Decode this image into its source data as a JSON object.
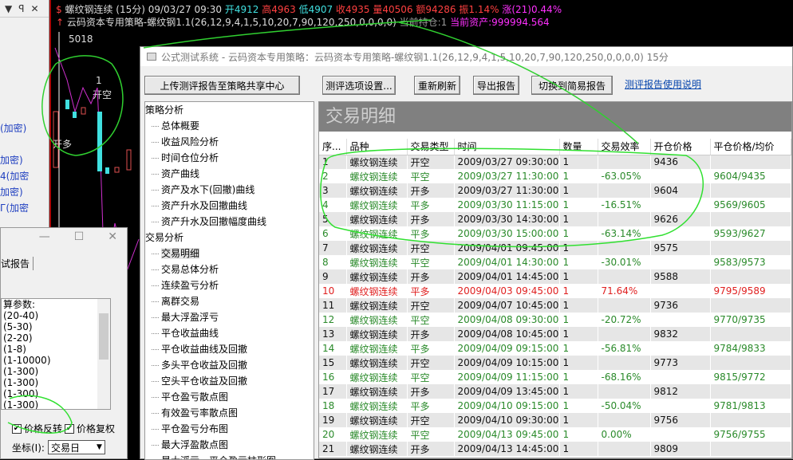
{
  "left_panel": {
    "header_icons": [
      "▼",
      "ꟼ",
      "✕"
    ],
    "items": [
      "(加密)",
      "加密)",
      "4(加密",
      "加密)",
      "Г(加密"
    ]
  },
  "chart": {
    "line1": {
      "symbol": "螺纹钢连续 (15分) 09/03/27 09:30",
      "open": "开4912",
      "high": "高4963",
      "low": "低4907",
      "close": "收4935",
      "vol": "量40506",
      "amount": "额94286",
      "amp": "振1.14%",
      "chg": "涨(21)0.44%"
    },
    "line2": {
      "strategy": "云码资本专用策略-螺纹钢1.1(26,12,9,4,1,5,10,20,7,90,120,250,0,0,0,0)",
      "position": "当前持仓:1",
      "assets": "当前资产:999994.564"
    },
    "price_label": "5018",
    "signal_open_long": "开多",
    "signal_open_short": "开空",
    "marker": "1"
  },
  "dialog": {
    "title": "公式测试系统 - 云码资本专用策略：云码资本专用策略-螺纹钢1.1(26,12,9,4,1,5,10,20,7,90,120,250,0,0,0,0) 15分",
    "buttons": {
      "upload": "上传测评报告至策略共享中心",
      "options": "测评选项设置...",
      "refresh": "重新刷新",
      "export": "导出报告",
      "switch": "切换到简易报告"
    },
    "help_link": "测评报告使用说明",
    "tree": [
      {
        "group": "策略分析",
        "items": [
          "总体概要",
          "收益风险分析",
          "时间仓位分析",
          "资产曲线",
          "资产及水下(回撤)曲线",
          "资产升水及回撤曲线",
          "资产升水及回撤幅度曲线"
        ]
      },
      {
        "group": "交易分析",
        "items": [
          "交易明细",
          "交易总体分析",
          "连续盈亏分析",
          "离群交易",
          "最大浮盈浮亏",
          "平仓收益曲线",
          "平仓收益曲线及回撤",
          "多头平仓收益及回撤",
          "空头平仓收益及回撤",
          "平仓盈亏散点图",
          "有效盈亏率散点图",
          "平仓盈亏分布图",
          "最大浮盈散点图",
          "最大浮亏—平仓盈亏柱形图"
        ]
      }
    ],
    "section_title": "交易明细",
    "columns": [
      "序...",
      "品种",
      "交易类型",
      "时间",
      "数量",
      "交易效率",
      "开仓价格",
      "平仓价格/均价"
    ],
    "rows": [
      [
        "1",
        "螺纹钢连续",
        "开空",
        "2009/03/27 09:30:00",
        "1",
        "",
        "9436",
        ""
      ],
      [
        "2",
        "螺纹钢连续",
        "平空",
        "2009/03/27 11:30:00",
        "1",
        "-63.05%",
        "",
        "9604/9435"
      ],
      [
        "3",
        "螺纹钢连续",
        "开多",
        "2009/03/27 11:30:00",
        "1",
        "",
        "9604",
        ""
      ],
      [
        "4",
        "螺纹钢连续",
        "平多",
        "2009/03/30 11:15:00",
        "1",
        "-16.51%",
        "",
        "9569/9605"
      ],
      [
        "5",
        "螺纹钢连续",
        "开多",
        "2009/03/30 14:30:00",
        "1",
        "",
        "9626",
        ""
      ],
      [
        "6",
        "螺纹钢连续",
        "平多",
        "2009/03/30 15:00:00",
        "1",
        "-63.14%",
        "",
        "9593/9627"
      ],
      [
        "7",
        "螺纹钢连续",
        "开空",
        "2009/04/01 09:45:00",
        "1",
        "",
        "9575",
        ""
      ],
      [
        "8",
        "螺纹钢连续",
        "平空",
        "2009/04/01 14:30:00",
        "1",
        "-30.01%",
        "",
        "9583/9573"
      ],
      [
        "9",
        "螺纹钢连续",
        "开多",
        "2009/04/01 14:45:00",
        "1",
        "",
        "9588",
        ""
      ],
      [
        "10",
        "螺纹钢连续",
        "平多",
        "2009/04/03 09:45:00",
        "1",
        "71.64%",
        "",
        "9795/9589"
      ],
      [
        "11",
        "螺纹钢连续",
        "开空",
        "2009/04/07 10:45:00",
        "1",
        "",
        "9736",
        ""
      ],
      [
        "12",
        "螺纹钢连续",
        "平空",
        "2009/04/08 09:30:00",
        "1",
        "-20.72%",
        "",
        "9770/9735"
      ],
      [
        "13",
        "螺纹钢连续",
        "开多",
        "2009/04/08 10:45:00",
        "1",
        "",
        "9832",
        ""
      ],
      [
        "14",
        "螺纹钢连续",
        "平多",
        "2009/04/09 09:15:00",
        "1",
        "-56.81%",
        "",
        "9784/9833"
      ],
      [
        "15",
        "螺纹钢连续",
        "开空",
        "2009/04/09 10:15:00",
        "1",
        "",
        "9773",
        ""
      ],
      [
        "16",
        "螺纹钢连续",
        "平空",
        "2009/04/09 11:15:00",
        "1",
        "-68.16%",
        "",
        "9815/9772"
      ],
      [
        "17",
        "螺纹钢连续",
        "开多",
        "2009/04/09 13:45:00",
        "1",
        "",
        "9812",
        ""
      ],
      [
        "18",
        "螺纹钢连续",
        "平多",
        "2009/04/10 09:15:00",
        "1",
        "-50.04%",
        "",
        "9781/9813"
      ],
      [
        "19",
        "螺纹钢连续",
        "开空",
        "2009/04/10 09:30:00",
        "1",
        "",
        "9756",
        ""
      ],
      [
        "20",
        "螺纹钢连续",
        "平空",
        "2009/04/13 09:45:00",
        "1",
        "0.00%",
        "",
        "9756/9755"
      ],
      [
        "21",
        "螺纹钢连续",
        "开多",
        "2009/04/13 14:45:00",
        "1",
        "",
        "9809",
        ""
      ]
    ]
  },
  "mini_dialog": {
    "controls": [
      "—",
      "☐",
      "✕"
    ],
    "tab": "试报告",
    "params": [
      "算参数:",
      "(20-40)",
      "(5-30)",
      "(2-20)",
      "(1-8)",
      "(1-10000)",
      "(1-300)",
      "(1-300)",
      "(1-300)",
      "(1-300)"
    ],
    "checkbox_reverse": "价格反转",
    "checkbox_adjust": "价格复权",
    "coord_label": "坐标(I):",
    "coord_value": "交易日"
  },
  "colors": {
    "close_row": "#2a8a2a",
    "loss_row": "#e02020",
    "annotation": "#30e030"
  }
}
